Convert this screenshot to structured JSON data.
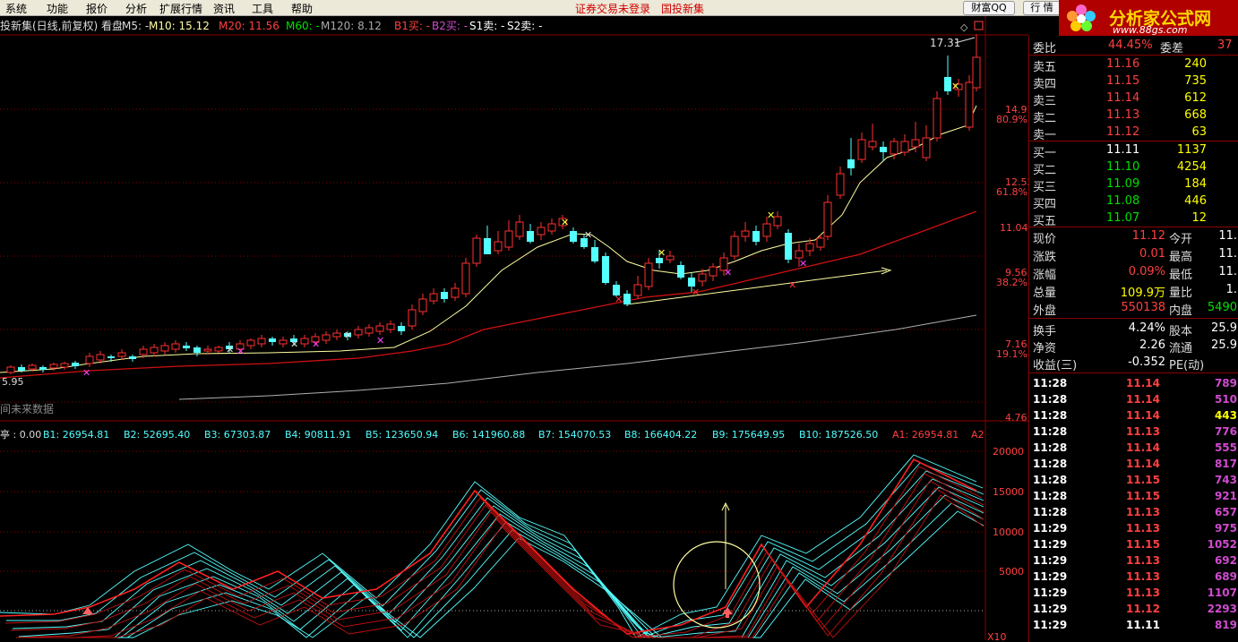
{
  "menu": {
    "items": [
      "系统",
      "功能",
      "报价",
      "分析",
      "扩展行情",
      "资讯",
      "工具",
      "帮助"
    ],
    "status_left": "证券交易未登录",
    "status_right": "国投新集",
    "caifu_btn": "财富QQ",
    "quote_btn": "行 情"
  },
  "logo": {
    "brand": "分析家公式网",
    "url": "www.88gs.com"
  },
  "chart": {
    "header": {
      "title": "投新集(日线,前复权) 看盘",
      "m5": "M5: -",
      "m10": "M10: 15.12",
      "m20": "M20: 11.56",
      "m60": "M60: -",
      "m120": "M120: 8.12",
      "b1": "B1买: -",
      "b2": "B2买: -",
      "s1": "S1卖: -",
      "s2": "S2卖: -"
    },
    "price_labels": {
      "p1731": "17.31",
      "p595": "5.95",
      "future": "间未来数据"
    },
    "y_axis": [
      {
        "price": "14.91",
        "pct": "80.9%"
      },
      {
        "price": "12.52",
        "pct": "61.8%"
      },
      {
        "price": "11.04",
        "pct": ""
      },
      {
        "price": "9.56",
        "pct": "38.2%"
      },
      {
        "price": "7.16",
        "pct": "19.1%"
      },
      {
        "price": "4.76",
        "pct": ""
      }
    ],
    "sub_header": {
      "lead": "亭 : 0.00",
      "b1": "B1: 26954.81",
      "b2": "B2: 52695.40",
      "b3": "B3: 67303.87",
      "b4": "B4: 90811.91",
      "b5": "B5: 123650.94",
      "b6": "B6: 141960.88",
      "b7": "B7: 154070.53",
      "b8": "B8: 166404.22",
      "b9": "B9: 175649.95",
      "b10": "B10: 187526.50",
      "a1": "A1: 26954.81",
      "a2": "A2"
    },
    "sub_y_axis": [
      "20000",
      "15000",
      "10000",
      "5000"
    ],
    "sub_unit": "X10"
  },
  "panel": {
    "top_row": {
      "label": "委比",
      "value": "44.45%",
      "label2": "委差",
      "value2": "37"
    },
    "sell": [
      {
        "label": "卖五",
        "price": "11.16",
        "vol": "240"
      },
      {
        "label": "卖四",
        "price": "11.15",
        "vol": "735"
      },
      {
        "label": "卖三",
        "price": "11.14",
        "vol": "612"
      },
      {
        "label": "卖二",
        "price": "11.13",
        "vol": "668"
      },
      {
        "label": "卖一",
        "price": "11.12",
        "vol": "63"
      }
    ],
    "buy": [
      {
        "label": "买一",
        "price": "11.11",
        "vol": "1137"
      },
      {
        "label": "买二",
        "price": "11.10",
        "vol": "4254"
      },
      {
        "label": "买三",
        "price": "11.09",
        "vol": "184"
      },
      {
        "label": "买四",
        "price": "11.08",
        "vol": "446"
      },
      {
        "label": "买五",
        "price": "11.07",
        "vol": "12"
      }
    ],
    "stats": [
      {
        "l1": "现价",
        "v1": "11.12",
        "l2": "今开",
        "v2": "11."
      },
      {
        "l1": "涨跌",
        "v1": "0.01",
        "l2": "最高",
        "v2": "11."
      },
      {
        "l1": "涨幅",
        "v1": "0.09%",
        "l2": "最低",
        "v2": "11."
      },
      {
        "l1": "总量",
        "v1": "109.9万",
        "l2": "量比",
        "v2": "1."
      },
      {
        "l1": "外盘",
        "v1": "550138",
        "l2": "内盘",
        "v2": "5490"
      }
    ],
    "fund": [
      {
        "l1": "换手",
        "v1": "4.24%",
        "l2": "股本",
        "v2": "25.9"
      },
      {
        "l1": "净资",
        "v1": "2.26",
        "l2": "流通",
        "v2": "25.9"
      },
      {
        "l1": "收益(三)",
        "v1": "-0.352",
        "l2": "PE(动)",
        "v2": ""
      }
    ],
    "ticks": [
      {
        "t": "11:28",
        "p": "11.14",
        "v": "789"
      },
      {
        "t": "11:28",
        "p": "11.14",
        "v": "510"
      },
      {
        "t": "11:28",
        "p": "11.14",
        "v": "443"
      },
      {
        "t": "11:28",
        "p": "11.13",
        "v": "776"
      },
      {
        "t": "11:28",
        "p": "11.14",
        "v": "555"
      },
      {
        "t": "11:28",
        "p": "11.14",
        "v": "817"
      },
      {
        "t": "11:28",
        "p": "11.15",
        "v": "743"
      },
      {
        "t": "11:28",
        "p": "11.15",
        "v": "921"
      },
      {
        "t": "11:28",
        "p": "11.13",
        "v": "657"
      },
      {
        "t": "11:29",
        "p": "11.13",
        "v": "975"
      },
      {
        "t": "11:29",
        "p": "11.15",
        "v": "1052"
      },
      {
        "t": "11:29",
        "p": "11.13",
        "v": "692"
      },
      {
        "t": "11:29",
        "p": "11.13",
        "v": "689"
      },
      {
        "t": "11:29",
        "p": "11.13",
        "v": "1107"
      },
      {
        "t": "11:29",
        "p": "11.12",
        "v": "2293"
      },
      {
        "t": "11:29",
        "p": "11.11",
        "v": "819"
      }
    ]
  },
  "colors": {
    "up": "#ff3030",
    "down": "#54ffff",
    "ma_white": "#ffffa0",
    "ma_red": "#d01010",
    "ma_gray": "#b0b0b0",
    "grid": "#8b0000"
  }
}
